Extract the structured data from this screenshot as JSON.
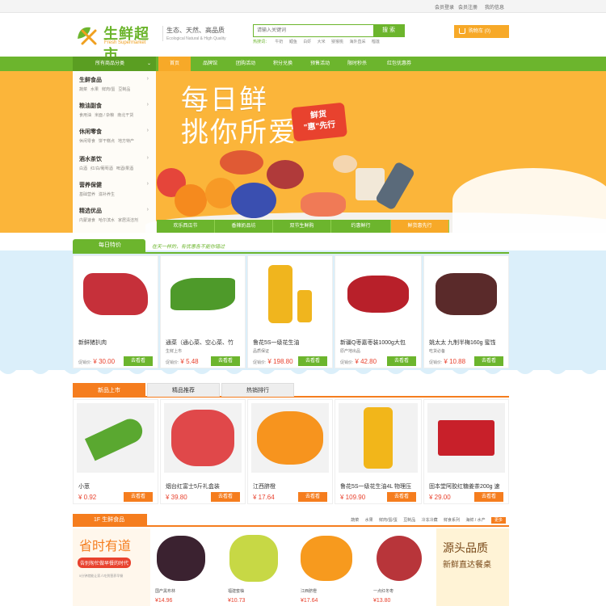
{
  "topbar": {
    "login": "会员登录",
    "register": "会员注册",
    "account": "我的信息"
  },
  "header": {
    "logo_text": "生鲜超市",
    "logo_sub": "Fresh Supermarket",
    "slogan": "生态、天然、高品质",
    "slogan_en": "Ecological Natural & High Quality",
    "search_placeholder": "请输入关键词",
    "search_button": "搜 索",
    "hot_label": "热搜词：",
    "hot_words": [
      "牛奶",
      "鲤鱼",
      "白虾",
      "大米",
      "猕猴桃",
      "海外直采",
      "榴莲"
    ],
    "cart_label": "购物车 (0)"
  },
  "nav": {
    "category_label": "所有商品分类",
    "items": [
      "首页",
      "品牌馆",
      "团购活动",
      "积分兑换",
      "预售活动",
      "限时秒杀",
      "红包优惠券"
    ]
  },
  "categories": [
    {
      "title": "生鲜食品",
      "subs": [
        "蔬菜",
        "水果",
        "鲜肉/蛋",
        "豆制品"
      ]
    },
    {
      "title": "粮油副食",
      "subs": [
        "食用油",
        "米面 / 杂粮",
        "南北干货"
      ]
    },
    {
      "title": "休闲零食",
      "subs": [
        "休闲零食",
        "饼干糕点",
        "地方特产"
      ]
    },
    {
      "title": "酒水茶饮",
      "subs": [
        "白酒",
        "红/白/葡萄酒",
        "啤酒/果酒"
      ]
    },
    {
      "title": "营养保健",
      "subs": [
        "基础营养",
        "滋补养生"
      ]
    },
    {
      "title": "精选优品",
      "subs": [
        "内蒙速食",
        "哈尔滨水",
        "家居清洁剂"
      ]
    }
  ],
  "banner": {
    "title1": "每日鲜",
    "title2": "挑你所爱",
    "badge1": "鲜货",
    "badge2": "\"惠\"先行",
    "tabs": [
      "欢乐西瓜节",
      "香辣奶品坊",
      "双节生鲜购",
      "约惠鲜行",
      "鲜货惠先行"
    ]
  },
  "daily": {
    "title": "每日特价",
    "tagline": "在天一样的，有优惠各不能你错过",
    "price_label": "促销价:",
    "buy_label": "去看看",
    "items": [
      {
        "name": "新鲜猪扒肉",
        "desc": "",
        "price": "¥ 30.00"
      },
      {
        "name": "通菜（通心菜、空心菜、竹",
        "desc": "生鲜上市",
        "price": "¥ 5.48"
      },
      {
        "name": "鲁花5S一级花生油",
        "desc": "品质保证",
        "price": "¥ 198.80"
      },
      {
        "name": "新疆Q枣嘉枣装1000g大包",
        "desc": "原产地出品",
        "price": "¥ 42.80"
      },
      {
        "name": "姚太太 九制半梅160g 蜜饯",
        "desc": "吃货必备",
        "price": "¥ 10.88"
      }
    ]
  },
  "newtabs": {
    "tabs": [
      "新品上市",
      "精品推荐",
      "热销排行"
    ],
    "buy_label": "去看看",
    "items": [
      {
        "name": "小葱",
        "price": "¥ 0.92"
      },
      {
        "name": "烟台红富士5斤礼盒装",
        "price": "¥ 39.80"
      },
      {
        "name": "江西脐橙",
        "price": "¥ 17.64"
      },
      {
        "name": "鲁花5S一级花生油4L 物理压",
        "price": "¥ 109.90"
      },
      {
        "name": "固本堂阿胶红糖姜茶200g 速",
        "price": "¥ 29.00"
      }
    ]
  },
  "floor": {
    "title": "1F 生鲜食品",
    "links": [
      "蔬菜",
      "水果",
      "鲜肉/蛋/蛋",
      "豆制品",
      "冷冻冷藏",
      "鲜食系列",
      "海鲜 / 水产"
    ],
    "more": "更多",
    "promo_left_title": "省时有道",
    "promo_left_sub": "告别匆忙做早餐的时代",
    "promo_left_small": "5分钟就能让家人吃到营养早餐",
    "promo_right_title": "源头品质",
    "promo_right_sub": "新鲜直达餐桌",
    "items": [
      {
        "name": "国产黑布林",
        "price": "¥14.96"
      },
      {
        "name": "福建蜜柚",
        "price": "¥10.73"
      },
      {
        "name": "江西脐橙",
        "price": "¥17.64"
      },
      {
        "name": "一点红冬枣",
        "price": "¥13.80"
      }
    ]
  },
  "colors": {
    "green": "#6cb52d",
    "orange": "#f57d1e",
    "yellow": "#f7a928",
    "red": "#e8422e"
  }
}
